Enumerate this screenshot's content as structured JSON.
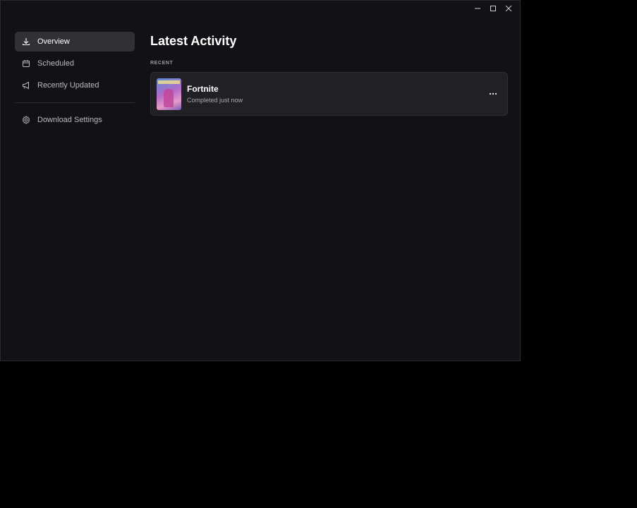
{
  "window_controls": {
    "minimize_icon": "minimize-icon",
    "maximize_icon": "maximize-icon",
    "close_icon": "close-icon"
  },
  "sidebar": {
    "items": [
      {
        "label": "Overview",
        "icon": "download-icon",
        "active": true
      },
      {
        "label": "Scheduled",
        "icon": "calendar-icon",
        "active": false
      },
      {
        "label": "Recently Updated",
        "icon": "megaphone-icon",
        "active": false
      }
    ],
    "settings": {
      "label": "Download Settings",
      "icon": "gear-icon"
    }
  },
  "main": {
    "title": "Latest Activity",
    "section_label": "RECENT",
    "items": [
      {
        "title": "Fortnite",
        "status": "Completed just now"
      }
    ]
  },
  "colors": {
    "window_bg": "#121216",
    "active_nav_bg": "#303035",
    "card_bg": "#202025"
  }
}
